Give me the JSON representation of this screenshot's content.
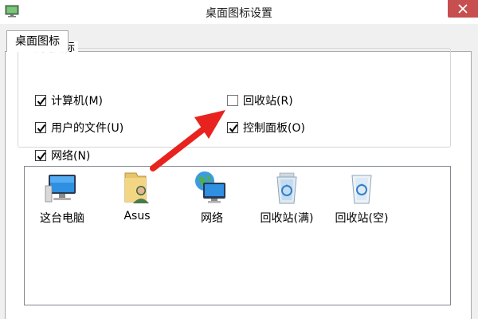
{
  "window": {
    "title": "桌面图标设置",
    "app_icon": "desktop-settings-icon",
    "close_icon": "close-icon",
    "close_color": "#c74f4f"
  },
  "tabs": [
    {
      "label": "桌面图标",
      "selected": true
    }
  ],
  "desktop_icons_group": {
    "legend": "桌面图标",
    "checkboxes": [
      {
        "label": "计算机(M)",
        "checked": true
      },
      {
        "label": "回收站(R)",
        "checked": false
      },
      {
        "label": "用户的文件(U)",
        "checked": true
      },
      {
        "label": "控制面板(O)",
        "checked": true
      },
      {
        "label": "网络(N)",
        "checked": true
      }
    ]
  },
  "icon_list": {
    "items": [
      {
        "label": "这台电脑",
        "icon": "computer-icon"
      },
      {
        "label": "Asus",
        "icon": "user-folder-icon"
      },
      {
        "label": "网络",
        "icon": "network-icon"
      },
      {
        "label": "回收站(满)",
        "icon": "recycle-bin-full-icon"
      },
      {
        "label": "回收站(空)",
        "icon": "recycle-bin-empty-icon"
      }
    ]
  },
  "annotation": {
    "type": "arrow",
    "color": "#e8231f",
    "points_to": "回收站(R)"
  }
}
